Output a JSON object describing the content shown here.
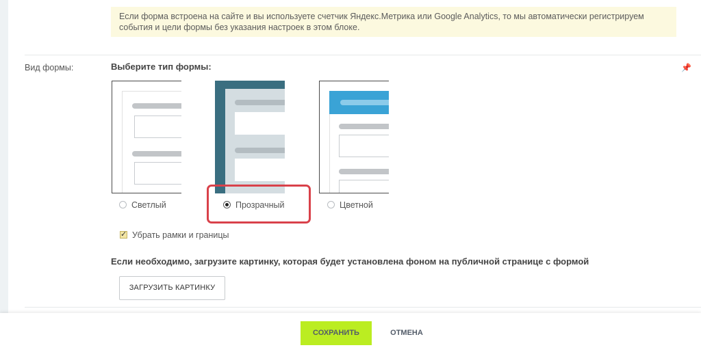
{
  "info_note": "Если форма встроена на сайте и вы используете счетчик Яндекс.Метрика или Google Analytics, то мы автоматически регистрируем события и цели формы без указания настроек в этом блоке.",
  "form_view": {
    "label": "Вид формы:",
    "heading": "Выберите тип формы:",
    "options": [
      {
        "label": "Светлый",
        "selected": false
      },
      {
        "label": "Прозрачный",
        "selected": true
      },
      {
        "label": "Цветной",
        "selected": false
      }
    ],
    "colors": {
      "transparent_bg": "#3a6e80",
      "color_header": "#3aa3d6",
      "highlight": "#d9414a"
    }
  },
  "remove_borders": {
    "label": "Убрать рамки и границы",
    "checked": true
  },
  "upload": {
    "text": "Если необходимо, загрузите картинку, которая будет установлена фоном на публичной странице с формой",
    "button": "ЗАГРУЗИТЬ КАРТИНКУ"
  },
  "footer": {
    "save": "СОХРАНИТЬ",
    "cancel": "ОТМЕНА",
    "save_color": "#bbed21"
  }
}
